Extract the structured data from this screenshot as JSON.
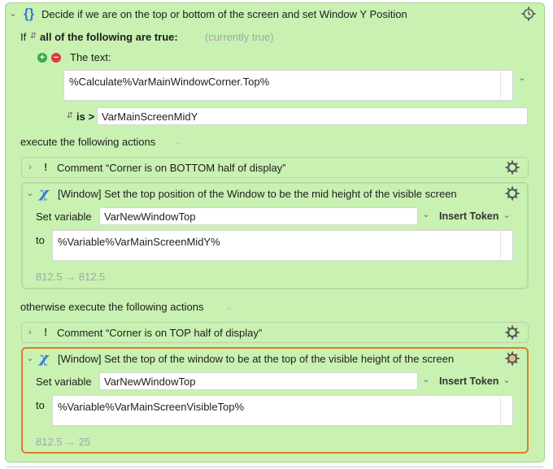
{
  "macro": {
    "title": "Decide if we are on the top or bottom of the screen and set Window Y Position",
    "title_icon": "braces-icon",
    "condition": {
      "if_label": "If",
      "mode": "all of the following are true:",
      "status": "(currently true)",
      "text_label": "The text:",
      "text_value": "%Calculate%VarMainWindowCorner.Top%",
      "operator": "is >",
      "compare_value": "VarMainScreenMidY"
    },
    "then_label": "execute the following actions",
    "else_label": "otherwise execute the following actions",
    "then_actions": {
      "comment": "Comment “Corner is on BOTTOM half of display”",
      "set_var": {
        "title": "[Window] Set the top position of the Window to be the mid height of the visible screen",
        "set_variable_label": "Set variable",
        "variable": "VarNewWindowTop",
        "insert_token": "Insert Token",
        "to_label": "to",
        "value": "%Variable%VarMainScreenMidY%",
        "result": "812.5 → 812.5"
      }
    },
    "else_actions": {
      "comment": "Comment “Corner is on TOP half of display”",
      "set_var": {
        "title": "[Window] Set the top of the window to be at the top of the visible height of the screen",
        "set_variable_label": "Set variable",
        "variable": "VarNewWindowTop",
        "insert_token": "Insert Token",
        "to_label": "to",
        "value": "%Variable%VarMainScreenVisibleTop%",
        "result": "812.5 → 25"
      }
    }
  },
  "colors": {
    "action_bg": "#c9f1b2",
    "selected_border": "#e07d25",
    "icon_blue": "#3c79d8"
  }
}
